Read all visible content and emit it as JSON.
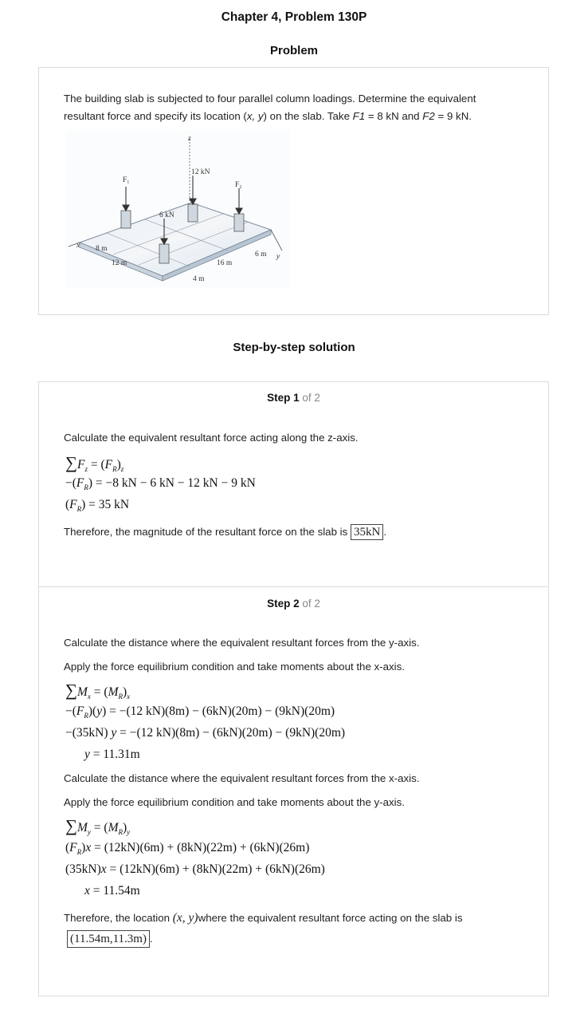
{
  "header": {
    "chapter_title": "Chapter 4, Problem 130P",
    "problem_heading": "Problem",
    "solution_heading": "Step-by-step solution"
  },
  "problem": {
    "text_line1": "The building slab is subjected to four parallel column loadings. Determine the equivalent",
    "text_line2_a": "resultant force and specify its location (",
    "text_line2_xy": "x, y",
    "text_line2_b": ") on the slab. Take ",
    "text_line2_f1": "F1",
    "text_line2_c": " = 8 kN and ",
    "text_line2_f2": "F2",
    "text_line2_d": " = 9 kN.",
    "figure_labels": {
      "z": "z",
      "kn12": "12 kN",
      "f1": "F₁",
      "f2": "F₂",
      "kn6": "6 kN",
      "x": "x",
      "y": "y",
      "m8": "8 m",
      "m12": "12 m",
      "m16": "16 m",
      "m6": "6 m",
      "m4": "4 m"
    }
  },
  "step1": {
    "label": "Step 1",
    "of": "of 2",
    "line1": "Calculate the equivalent resultant force acting along the z-axis.",
    "eq1": "∑F_z = (F_R)_z",
    "eq2": "−(F_R) = −8 kN − 6 kN − 12 kN − 9 kN",
    "eq3": "(F_R) = 35 kN",
    "conclusion": "Therefore, the magnitude of the resultant force on the slab is",
    "answer": "35kN",
    "period": "."
  },
  "step2": {
    "label": "Step 2",
    "of": "of 2",
    "line1": "Calculate the distance where the equivalent resultant forces from the y-axis.",
    "line2": "Apply the force equilibrium condition and take moments about the x-axis.",
    "eq1": "∑M_x = (M_R)_x",
    "eq2": "−(F_R)(y) = −(12 kN)(8m) − (6kN)(20m) − (9kN)(20m)",
    "eq3": "−(35kN) y = −(12 kN)(8m) − (6kN)(20m) − (9kN)(20m)",
    "eq4": "y = 11.31m",
    "line3": "Calculate the distance where the equivalent resultant forces from the x-axis.",
    "line4": "Apply the force equilibrium condition and take moments about the y-axis.",
    "eq5": "∑M_y = (M_R)_y",
    "eq6": "(F_R)x = (12kN)(6m) + (8kN)(22m) + (6kN)(26m)",
    "eq7": "(35kN)x = (12kN)(6m) + (8kN)(22m) + (6kN)(26m)",
    "eq8": "x = 11.54m",
    "conclusion_a": "Therefore, the location",
    "conclusion_xy": "(x, y)",
    "conclusion_b": "where the equivalent resultant force acting on the slab is",
    "answer": "(11.54m,11.3m)",
    "period": "."
  }
}
